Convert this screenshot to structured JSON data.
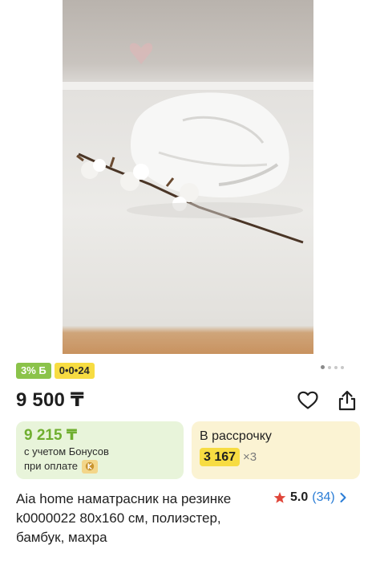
{
  "product": {
    "image_alt": "Aia home наматрасник на резинке",
    "bonus_badge": "3% Б",
    "installment_badge": "0•0•24",
    "price": "9 500 ₸",
    "bonus_card": {
      "price": "9 215 ₸",
      "line1": "с учетом Бонусов",
      "line2": "при оплате"
    },
    "installment_card": {
      "title": "В рассрочку",
      "amount": "3 167",
      "multiplier": "×3"
    },
    "title": "Aia home наматрасник на резинке k0000022 80x160 см, полиэстер, бамбук, махра",
    "rating": {
      "value": "5.0",
      "count": "(34)"
    }
  },
  "gallery": {
    "total_images": 4,
    "active_index": 0
  },
  "colors": {
    "bonus_green": "#8bc34a",
    "bonus_text_green": "#6fae2f",
    "installment_yellow": "#f7dc42",
    "link_blue": "#2a7dd6",
    "star_red": "#e0463a"
  }
}
